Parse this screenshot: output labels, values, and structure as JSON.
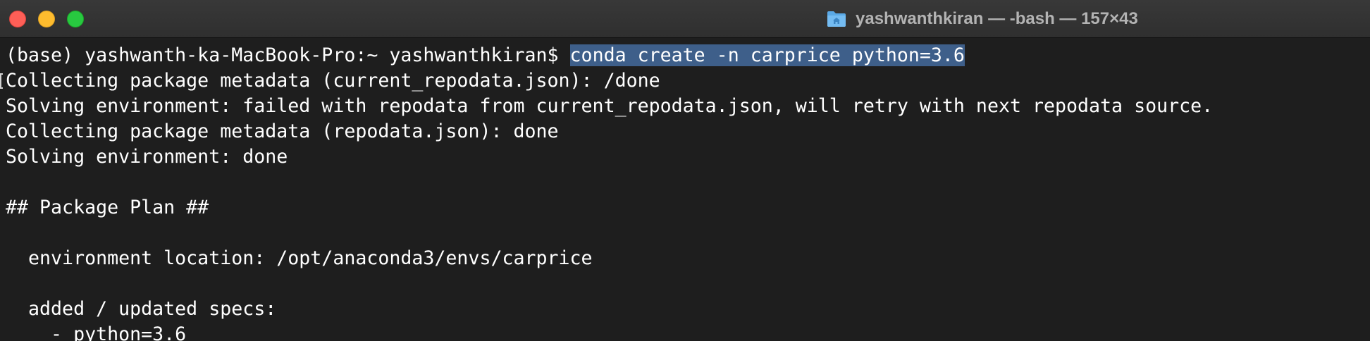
{
  "window": {
    "title": "yashwanthkiran — -bash — 157×43",
    "folder_icon": "home-folder-icon"
  },
  "colors": {
    "background": "#1e1e1e",
    "text": "#ffffff",
    "selection": "#3e5f8a",
    "close": "#fe5f57",
    "minimize": "#febc2e",
    "zoom": "#28c840"
  },
  "terminal": {
    "prompt": "(base) yashwanth-ka-MacBook-Pro:~ yashwanthkiran$ ",
    "command": "conda create -n carprice python=3.6",
    "lines": [
      "Collecting package metadata (current_repodata.json): /done",
      "Solving environment: failed with repodata from current_repodata.json, will retry with next repodata source.",
      "Collecting package metadata (repodata.json): done",
      "Solving environment: done",
      "",
      "## Package Plan ##",
      "",
      "  environment location: /opt/anaconda3/envs/carprice",
      "",
      "  added / updated specs:",
      "    - python=3.6"
    ]
  }
}
